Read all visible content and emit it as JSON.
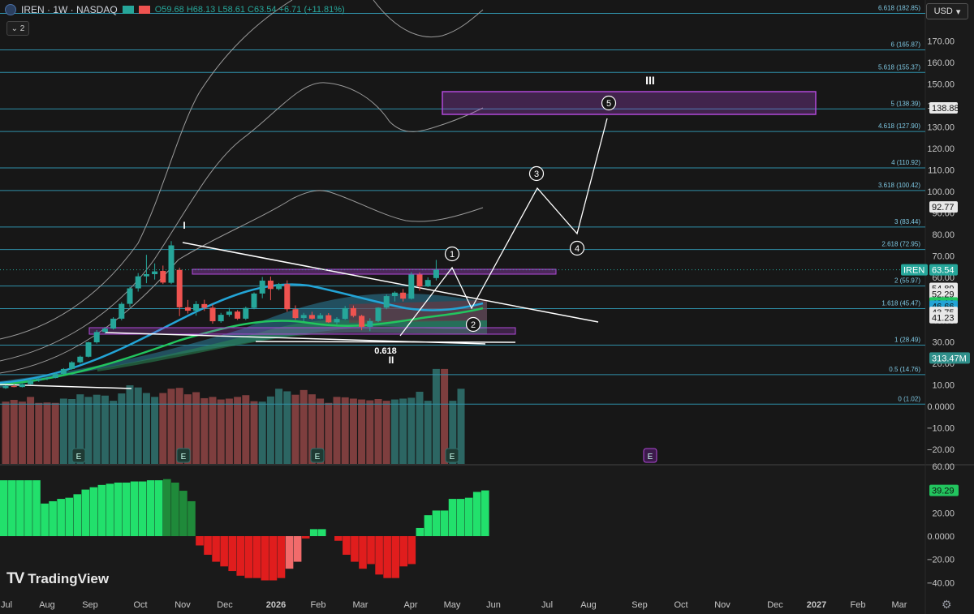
{
  "header": {
    "title": "IREN · 1W · NASDAQ",
    "ohlc": "O59.68 H68.13 L58.61 C63.54 +6.71 (+11.81%)",
    "collapse_label": "⌄ 2",
    "currency": "USD"
  },
  "watermark": "TradingView",
  "colors": {
    "up": "#26a69a",
    "down": "#ef5350",
    "grid_line": "#2f8fa8",
    "accent": "#b048d8",
    "osc_up": "#22e06c",
    "osc_down": "#e01d1d"
  },
  "chart_data": [
    {
      "type": "candlestick",
      "title": "IREN · 1W · NASDAQ",
      "x_labels": [
        "Jul",
        "Aug",
        "Sep",
        "Oct",
        "Nov",
        "Dec",
        "2026",
        "Feb",
        "Mar",
        "Apr",
        "May",
        "Jun",
        "Jul",
        "Aug",
        "Sep",
        "Oct",
        "Nov",
        "Dec",
        "2027",
        "Feb",
        "Mar"
      ],
      "y_ticks": [
        170,
        160,
        150,
        140,
        130,
        120,
        110,
        100,
        90,
        80,
        70,
        60,
        50,
        40,
        30,
        20,
        10,
        0,
        -10,
        -20
      ],
      "y_tick_labels": [
        "170.00",
        "160.00",
        "150.00",
        "140.00",
        "130.00",
        "120.00",
        "110.00",
        "100.00",
        "90.00",
        "80.00",
        "70.00",
        "60.00",
        "50.00",
        "40.00",
        "30.00",
        "20.00",
        "10.00",
        "0.0000",
        "−10.00",
        "−20.00"
      ],
      "ylim": [
        -23,
        190
      ],
      "candles": [
        [
          8.5,
          9.8,
          8.1,
          9.4
        ],
        [
          9.4,
          10.2,
          8.9,
          9.0
        ],
        [
          9.0,
          10.5,
          8.8,
          10.3
        ],
        [
          10.3,
          12.4,
          10.1,
          12.0
        ],
        [
          12.0,
          13.5,
          11.4,
          12.9
        ],
        [
          12.9,
          13.6,
          12.2,
          13.2
        ],
        [
          13.2,
          15.6,
          13.0,
          15.1
        ],
        [
          15.1,
          17.8,
          14.7,
          17.4
        ],
        [
          17.4,
          21.0,
          17.1,
          20.5
        ],
        [
          20.5,
          23.6,
          19.9,
          23.1
        ],
        [
          23.1,
          30.1,
          22.8,
          29.8
        ],
        [
          29.8,
          35.5,
          29.2,
          34.6
        ],
        [
          34.6,
          37.0,
          33.8,
          36.2
        ],
        [
          36.2,
          41.5,
          35.7,
          40.8
        ],
        [
          40.8,
          48.5,
          40.0,
          47.7
        ],
        [
          47.7,
          55.5,
          46.2,
          54.9
        ],
        [
          54.9,
          62.0,
          53.4,
          60.5
        ],
        [
          60.5,
          70.5,
          57.3,
          61.5
        ],
        [
          61.5,
          66.5,
          59.0,
          62.8
        ],
        [
          63.0,
          65.5,
          56.9,
          57.6
        ],
        [
          57.5,
          76.9,
          56.9,
          74.9
        ],
        [
          63.5,
          64.5,
          42.0,
          46.1
        ],
        [
          46.1,
          49.5,
          43.2,
          44.5
        ],
        [
          44.5,
          49.0,
          42.2,
          47.6
        ],
        [
          47.6,
          49.6,
          44.4,
          45.9
        ],
        [
          45.9,
          47.4,
          38.5,
          39.6
        ],
        [
          39.6,
          43.5,
          38.9,
          42.6
        ],
        [
          42.6,
          45.8,
          41.7,
          44.1
        ],
        [
          44.1,
          44.8,
          40.2,
          40.8
        ],
        [
          40.8,
          46.4,
          40.2,
          45.8
        ],
        [
          45.8,
          53.0,
          45.2,
          52.5
        ],
        [
          52.5,
          60.2,
          50.3,
          58.5
        ],
        [
          58.5,
          60.4,
          49.4,
          54.6
        ],
        [
          54.6,
          57.4,
          54.0,
          56.9
        ],
        [
          56.9,
          58.6,
          44.0,
          45.2
        ],
        [
          45.2,
          47.0,
          40.3,
          41.1
        ],
        [
          41.1,
          43.5,
          39.6,
          42.5
        ],
        [
          42.5,
          44.0,
          40.3,
          40.8
        ],
        [
          40.8,
          43.4,
          40.6,
          42.4
        ],
        [
          42.4,
          43.4,
          38.8,
          39.1
        ],
        [
          39.1,
          41.5,
          38.2,
          40.7
        ],
        [
          40.7,
          46.7,
          40.3,
          45.7
        ],
        [
          45.7,
          46.9,
          41.4,
          42.1
        ],
        [
          42.1,
          42.6,
          35.4,
          37.0
        ],
        [
          37.0,
          41.0,
          35.0,
          39.7
        ],
        [
          39.7,
          46.1,
          39.2,
          45.9
        ],
        [
          45.9,
          52.1,
          45.2,
          51.3
        ],
        [
          51.3,
          53.5,
          48.8,
          52.9
        ],
        [
          52.9,
          54.6,
          48.8,
          50.1
        ],
        [
          50.1,
          62.4,
          49.7,
          61.3
        ],
        [
          61.3,
          62.3,
          53.8,
          55.8
        ],
        [
          55.8,
          60.0,
          55.5,
          58.8
        ],
        [
          59.68,
          68.13,
          58.61,
          63.54
        ]
      ],
      "volume": [
        [
          2.2,
          "down"
        ],
        [
          3.0,
          "down"
        ],
        [
          2.2,
          "down"
        ],
        [
          4.4,
          "down"
        ],
        [
          1.6,
          "down"
        ],
        [
          1.8,
          "down"
        ],
        [
          1.6,
          "down"
        ],
        [
          3.6,
          "up"
        ],
        [
          3.4,
          "up"
        ],
        [
          5.6,
          "up"
        ],
        [
          4.4,
          "up"
        ],
        [
          5.4,
          "up"
        ],
        [
          5.0,
          "up"
        ],
        [
          2.6,
          "up"
        ],
        [
          6.0,
          "up"
        ],
        [
          9.8,
          "up"
        ],
        [
          8.8,
          "up"
        ],
        [
          6.2,
          "up"
        ],
        [
          4.4,
          "up"
        ],
        [
          6.2,
          "down"
        ],
        [
          8.2,
          "down"
        ],
        [
          8.6,
          "down"
        ],
        [
          5.6,
          "down"
        ],
        [
          6.6,
          "down"
        ],
        [
          3.8,
          "down"
        ],
        [
          4.4,
          "down"
        ],
        [
          3.2,
          "down"
        ],
        [
          3.6,
          "down"
        ],
        [
          4.4,
          "down"
        ],
        [
          5.2,
          "down"
        ],
        [
          2.4,
          "down"
        ],
        [
          2.2,
          "up"
        ],
        [
          4.6,
          "up"
        ],
        [
          8.2,
          "up"
        ],
        [
          7.0,
          "up"
        ],
        [
          5.4,
          "down"
        ],
        [
          7.6,
          "down"
        ],
        [
          5.6,
          "down"
        ],
        [
          3.6,
          "down"
        ],
        [
          1.6,
          "down"
        ],
        [
          4.4,
          "down"
        ],
        [
          4.2,
          "down"
        ],
        [
          3.6,
          "down"
        ],
        [
          3.2,
          "down"
        ],
        [
          2.8,
          "down"
        ],
        [
          3.4,
          "down"
        ],
        [
          2.6,
          "down"
        ],
        [
          3.2,
          "up"
        ],
        [
          3.6,
          "up"
        ],
        [
          4.0,
          "up"
        ],
        [
          6.8,
          "up"
        ],
        [
          2.6,
          "up"
        ],
        [
          17.4,
          "up"
        ],
        [
          17.4,
          "down"
        ],
        [
          2.6,
          "up"
        ],
        [
          8.2,
          "up"
        ]
      ],
      "fib_levels": [
        {
          "label": "6.618 (182.85)",
          "value": 182.85
        },
        {
          "label": "6 (165.87)",
          "value": 165.87
        },
        {
          "label": "5.618 (155.37)",
          "value": 155.37
        },
        {
          "label": "5 (138.39)",
          "value": 138.39
        },
        {
          "label": "4.618 (127.90)",
          "value": 127.9
        },
        {
          "label": "4 (110.92)",
          "value": 110.92
        },
        {
          "label": "3.618 (100.42)",
          "value": 100.42
        },
        {
          "label": "3 (83.44)",
          "value": 83.44
        },
        {
          "label": "2.618 (72.95)",
          "value": 72.95
        },
        {
          "label": "2 (55.97)",
          "value": 55.97
        },
        {
          "label": "1.618 (45.47)",
          "value": 45.47
        },
        {
          "label": "1 (28.49)",
          "value": 28.49
        },
        {
          "label": "0.5 (14.76)",
          "value": 14.76
        },
        {
          "label": "0 (1.02)",
          "value": 1.02
        }
      ],
      "price_tags": [
        {
          "text": "138.88",
          "value": 138.88,
          "style": "light"
        },
        {
          "text": "92.77",
          "value": 92.77,
          "style": "light"
        },
        {
          "text": "54.89",
          "value": 54.89,
          "style": "light"
        },
        {
          "text": "52.29",
          "value": 52.29,
          "style": "light"
        },
        {
          "text": "48.16",
          "value": 48.16,
          "style": "green"
        },
        {
          "text": "46.66",
          "value": 46.66,
          "style": "blue"
        },
        {
          "text": "43.75",
          "value": 43.75,
          "style": "light"
        },
        {
          "text": "41.23",
          "value": 41.23,
          "style": "light"
        },
        {
          "text": "313.47M",
          "value": 22.5,
          "style": "teal"
        }
      ],
      "last_price": {
        "symbol": "IREN",
        "value": "63.54",
        "y": 63.54
      },
      "wave_labels": {
        "circled": [
          "1",
          "2",
          "3",
          "4",
          "5"
        ],
        "roman": [
          "I",
          "II",
          "III"
        ],
        "fib_note": "0.618"
      },
      "earnings_markers": [
        "E",
        "E",
        "E",
        "E",
        "E"
      ]
    },
    {
      "type": "bar",
      "title": "",
      "ylim": [
        -45,
        60
      ],
      "y_ticks": [
        60,
        40,
        20,
        0,
        -20,
        -40
      ],
      "y_tick_labels": [
        "60.00",
        "40.00",
        "20.00",
        "0.0000",
        "−20.00",
        "−40.00"
      ],
      "last_value": "39.29",
      "values": [
        48,
        48,
        48,
        48,
        48,
        28,
        30,
        32,
        33,
        36,
        40,
        42,
        44,
        45,
        46,
        46,
        47,
        47,
        48,
        48,
        49,
        46,
        39,
        30,
        -8,
        -16,
        -22,
        -26,
        -30,
        -34,
        -36,
        -36,
        -38,
        -38,
        -36,
        -28,
        -22,
        -2,
        6,
        6,
        0,
        -4,
        -16,
        -22,
        -28,
        -24,
        -33,
        -36,
        -36,
        -26,
        -24,
        7,
        18,
        22,
        22,
        32,
        32,
        33,
        38,
        39.29
      ]
    }
  ]
}
